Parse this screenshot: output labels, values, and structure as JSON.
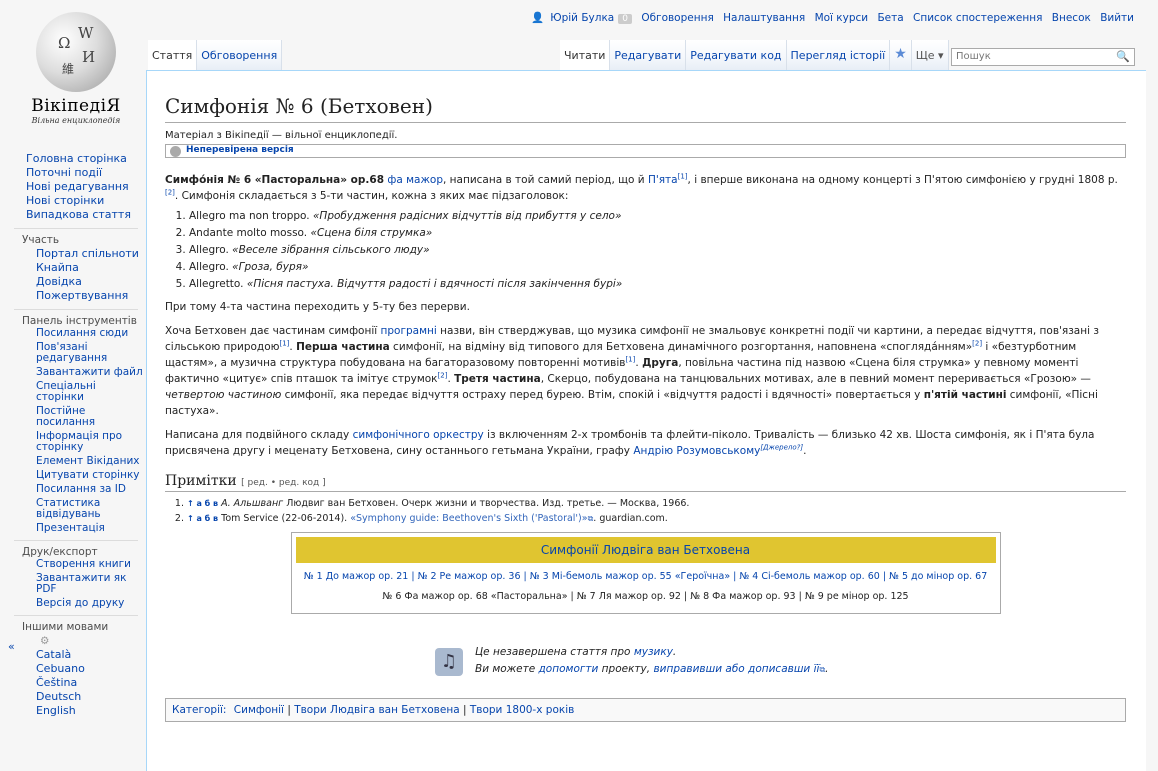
{
  "logo": {
    "wordmark": "ВікіпедіЯ",
    "tagline": "Вільна енциклопедія",
    "glyphs": [
      "Ω",
      "W",
      "И",
      "維"
    ]
  },
  "personal": {
    "user": "Юрій Булка",
    "count": "0",
    "links": [
      "Обговорення",
      "Налаштування",
      "Мої курси",
      "Бета",
      "Список спостереження",
      "Внесок",
      "Вийти"
    ]
  },
  "tabs": {
    "left": [
      "Стаття",
      "Обговорення"
    ],
    "right": [
      "Читати",
      "Редагувати",
      "Редагувати код",
      "Перегляд історії"
    ],
    "more": "Ще ▾"
  },
  "search": {
    "placeholder": "Пошук"
  },
  "sidebar": {
    "main": [
      "Головна сторінка",
      "Поточні події",
      "Нові редагування",
      "Нові сторінки",
      "Випадкова стаття"
    ],
    "participation_title": "Участь",
    "participation": [
      "Портал спільноти",
      "Кнайпа",
      "Довідка",
      "Пожертвування"
    ],
    "tools_title": "Панель інструментів",
    "tools": [
      "Посилання сюди",
      "Пов'язані редагування",
      "Завантажити файл",
      "Спеціальні сторінки",
      "Постійне посилання",
      "Інформація про сторінку",
      "Елемент Вікіданих",
      "Цитувати сторінку",
      "Посилання за ID",
      "Статистика відвідувань",
      "Презентація"
    ],
    "print_title": "Друк/експорт",
    "print": [
      "Створення книги",
      "Завантажити як PDF",
      "Версія до друку"
    ],
    "lang_title": "Іншими мовами",
    "langs": [
      "Català",
      "Cebuano",
      "Čeština",
      "Deutsch",
      "English"
    ],
    "collapse": "«"
  },
  "article": {
    "title": "Симфонія № 6 (Бетховен)",
    "sitesub": "Матеріал з Вікіпедії — вільної енциклопедії.",
    "unchecked": "Неперевірена версія",
    "intro_bold": "Симфо́нія № 6 «Пасторальна» ор.68",
    "intro_link1": "фа мажор",
    "intro_t1": ", написана в той самий період, що й ",
    "intro_link2": "П'ята",
    "intro_sup1": "[1]",
    "intro_t2": ", і вперше виконана на одному концерті з П'ятою симфонією у грудні 1808 р.",
    "intro_sup2": "[2]",
    "intro_t3": ". Симфонія складається з 5-ти частин, кожна з яких має підзаголовок:",
    "movements": [
      {
        "tempo": "Allegro ma non troppo.",
        "title": "«Пробудження радісних відчуттів від прибуття у село»"
      },
      {
        "tempo": "Andante molto mosso.",
        "title": "«Сцена біля струмка»"
      },
      {
        "tempo": "Allegro.",
        "title": "«Веселе зібрання сільського люду»"
      },
      {
        "tempo": "Allegro.",
        "title": "«Гроза, буря»"
      },
      {
        "tempo": "Allegretto.",
        "title": "«Пісня пастуха. Відчуття радості і вдячності після закінчення бурі»"
      }
    ],
    "p2": "При тому 4-та частина переходить у 5-ту без перерви.",
    "p3_a": "Хоча Бетховен дає частинам симфонії ",
    "p3_link": "програмні",
    "p3_b": " назви, він стверджував, що музика симфонії не змальовує конкретні події чи картини, а передає відчуття, пов'язані з сільською природою",
    "p3_sup1": "[1]",
    "p3_c": ". ",
    "p3_bold1": "Перша частина",
    "p3_d": " симфонії, на відміну від типового для Бетховена динамічного розгортання, наповнена «споглядáнням»",
    "p3_sup2": "[2]",
    "p3_e": " і «безтурботним щастям», а музична структура побудована на багаторазовому повторенні мотивів",
    "p3_sup3": "[1]",
    "p3_f": ". ",
    "p3_bold2": "Друга",
    "p3_g": ", повільна частина під назвою «Сцена біля струмка» у певному моменті фактично «цитує» спів пташок та імітує струмок",
    "p3_sup4": "[2]",
    "p3_h": ". ",
    "p3_bold3": "Третя частина",
    "p3_i": ", Скерцо, побудована на танцювальних мотивах, але в певний момент переривається «Грозою» — ",
    "p3_ital": "четвертою частиною",
    "p3_j": " симфонії, яка передає відчуття остраху перед бурею. Втім, спокій і «відчуття радості і вдячності» повертається у ",
    "p3_bold4": "п'ятій частині",
    "p3_k": " симфонії, «Пісні пастуха».",
    "p4_a": "Написана для подвійного складу ",
    "p4_link1": "симфонічного оркестру",
    "p4_b": " із включенням 2-х тромбонів та флейти-пiколо. Тривалість — близько 42 хв. Шоста симфонія, як і П'ята була присвячена другу і меценату Бетховена, сину останнього гетьмана України, графу ",
    "p4_link2": "Андрію Розумовському",
    "p4_sup": "[Джерело?]",
    "p4_c": ".",
    "notes_title": "Примітки",
    "notes_edit": "[ ред. • ред. код ]",
    "refs": [
      {
        "marks": "↑ а б в",
        "author": "А. Альшванг",
        "text": " Людвиг ван Бетховен. Очерк жизни и творчества. Изд. третье. — Москва, 1966."
      },
      {
        "marks": "↑ а б в",
        "author": "",
        "text": "Tom Service (22-06-2014). ",
        "link": "«Symphony guide: Beethoven's Sixth ('Pastoral')»",
        "tail": ". guardian.com."
      }
    ],
    "navbox": {
      "title": "Симфонії Людвіга ван Бетховена",
      "row1": "№ 1 До мажор ор. 21 | № 2 Ре мажор ор. 36 | № 3 Мі-бемоль мажор ор. 55 «Героїчна» | № 4 Сі-бемоль мажор ор. 60 | № 5 до мінор ор. 67",
      "row2": "№ 6 Фа мажор ор. 68 «Пасторальна» | № 7 Ля мажор ор. 92 | № 8 Фа мажор ор. 93 | № 9 ре мінор ор. 125"
    },
    "stub": {
      "l1a": "Це незавершена стаття про ",
      "l1link": "музику",
      "l1b": ".",
      "l2a": "Ви можете ",
      "l2link1": "допомогти",
      "l2b": " проекту, ",
      "l2link2": "виправивши або дописавши її",
      "l2c": "."
    },
    "categories": {
      "label": "Категорії:",
      "items": [
        "Симфонії",
        "Твори Людвіга ван Бетховена",
        "Твори 1800-х років"
      ]
    }
  }
}
